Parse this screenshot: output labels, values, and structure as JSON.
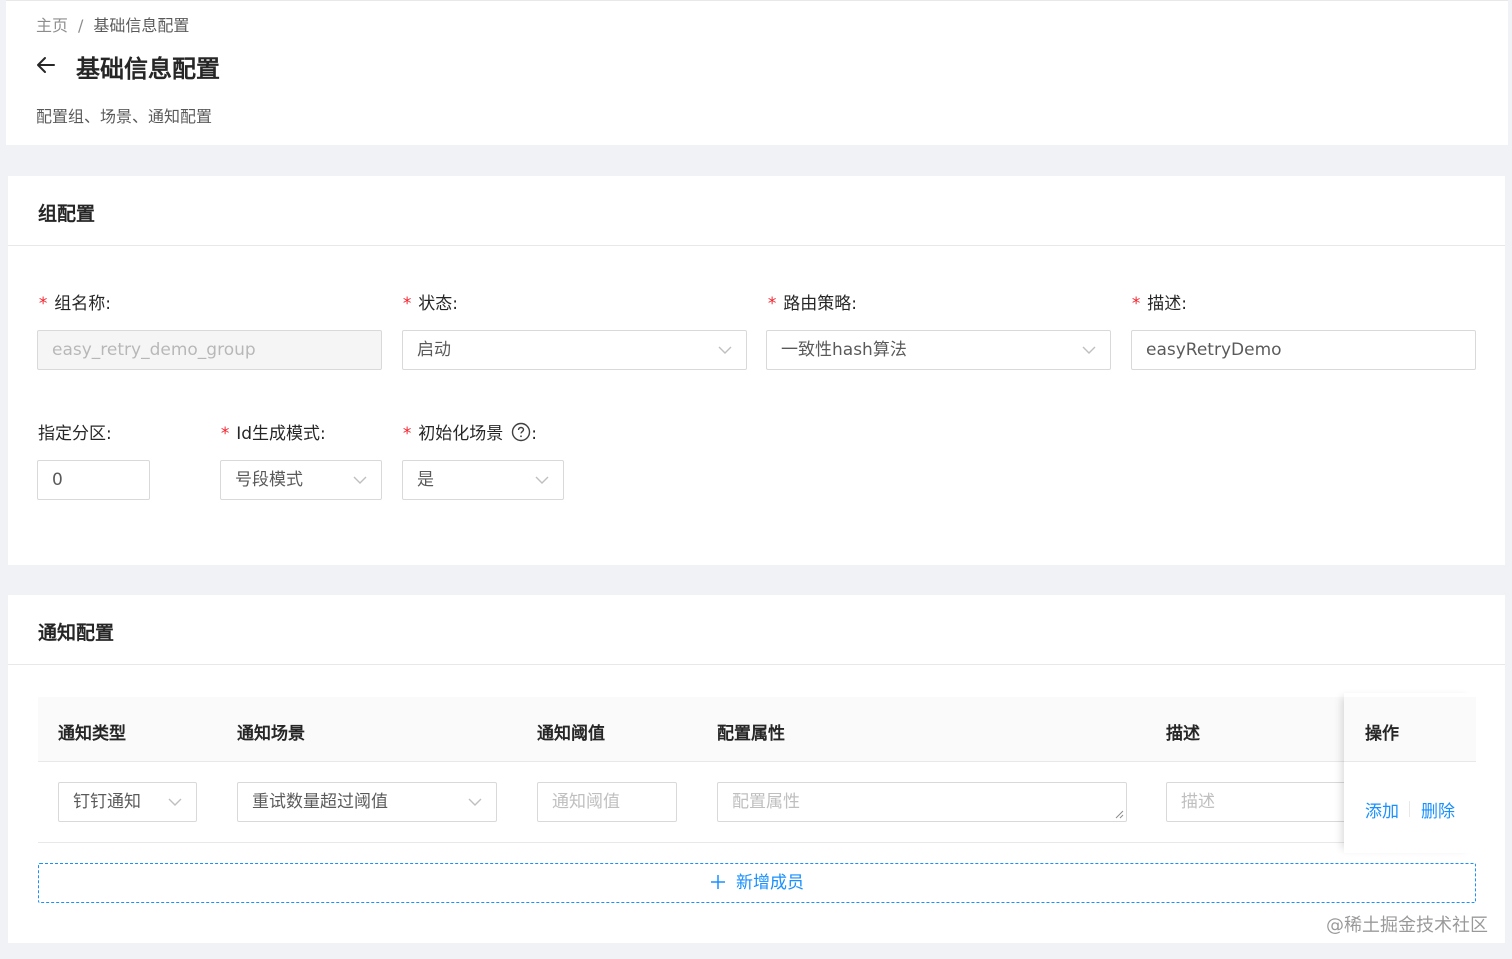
{
  "breadcrumb": {
    "home": "主页",
    "separator": "/",
    "current": "基础信息配置"
  },
  "page": {
    "title": "基础信息配置",
    "subtitle": "配置组、场景、通知配置"
  },
  "group_config": {
    "title": "组配置",
    "fields": {
      "group_name": {
        "label": "组名称:",
        "value": "easy_retry_demo_group",
        "disabled": true,
        "required": true
      },
      "status": {
        "label": "状态:",
        "value": "启动",
        "required": true
      },
      "route_strategy": {
        "label": "路由策略:",
        "value": "一致性hash算法",
        "required": true
      },
      "description": {
        "label": "描述:",
        "value": "easyRetryDemo",
        "required": true
      },
      "partition": {
        "label": "指定分区:",
        "value": "0"
      },
      "id_mode": {
        "label": "Id生成模式:",
        "value": "号段模式",
        "required": true
      },
      "init_scene": {
        "label": "初始化场景",
        "label_suffix": ":",
        "value": "是",
        "required": true
      }
    }
  },
  "notify_config": {
    "title": "通知配置",
    "columns": [
      "通知类型",
      "通知场景",
      "通知阈值",
      "配置属性",
      "描述",
      "操作"
    ],
    "row": {
      "type": "钉钉通知",
      "scene": "重试数量超过阈值",
      "threshold_placeholder": "通知阈值",
      "attribute_placeholder": "配置属性",
      "description_placeholder": "描述",
      "actions": [
        "添加",
        "删除"
      ]
    },
    "add_member": "新增成员"
  },
  "watermark": "@稀土掘金技术社区",
  "colors": {
    "primary": "#1890ff",
    "required": "#f5222d",
    "background": "#f0f2f5"
  }
}
